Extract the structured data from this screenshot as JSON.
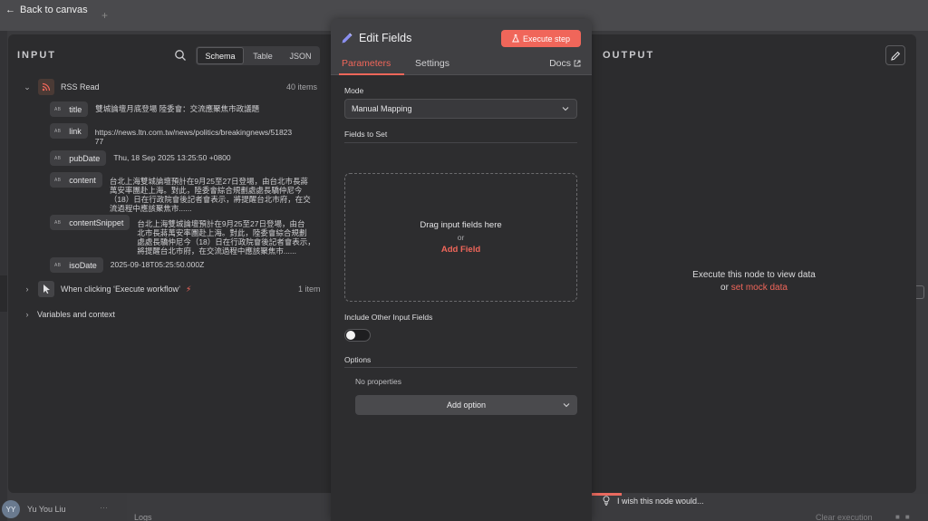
{
  "topbar": {
    "back_label": "Back to canvas",
    "back_icon": "arrow-left-icon"
  },
  "user": {
    "initials": "YY",
    "name": "Yu You Liu"
  },
  "bottom": {
    "logs_label": "Logs",
    "clear_label": "Clear execution"
  },
  "input": {
    "title": "INPUT",
    "view_tabs": [
      "Schema",
      "Table",
      "JSON"
    ],
    "active_view": "Schema",
    "nodes": [
      {
        "name": "RSS Read",
        "count": "40 items",
        "expanded": true
      },
      {
        "name": "When clicking ‘Execute workflow’",
        "count": "1 item",
        "expanded": false
      },
      {
        "name": "Variables and context"
      }
    ],
    "fields": [
      {
        "key": "title",
        "type_badge": "AB",
        "value": "雙城論壇月底登場 陸委會：交流應聚焦市政議題"
      },
      {
        "key": "link",
        "type_badge": "AB",
        "value_line1": "https://news.ltn.com.tw/news/politics/breakingnews/51823",
        "value_line2": "77"
      },
      {
        "key": "pubDate",
        "type_badge": "AB",
        "value": "Thu, 18 Sep 2025 13:25:50 +0800"
      },
      {
        "key": "content",
        "type_badge": "AB",
        "value_line1": "台北上海雙城論壇預計在9月25至27日登場，由台北市長蔣",
        "value_line2": "萬安率團赴上海。對此，陸委會綜合規劃處處長驕仲尼今",
        "value_line3": "（18）日在行政院會後記者會表示，將提醒台北市府，在交",
        "value_line4": "流過程中應該聚焦市......"
      },
      {
        "key": "contentSnippet",
        "type_badge": "AB",
        "value_line1": "台北上海雙城論壇預計在9月25至27日登場，由台",
        "value_line2": "北市長蔣萬安率團赴上海。對此，陸委會綜合規劃",
        "value_line3": "處處長驕仲尼今（18）日在行政院會後記者會表示，",
        "value_line4": "將提醒台北市府，在交流過程中應該聚焦市......"
      },
      {
        "key": "isoDate",
        "type_badge": "AB",
        "value": "2025-09-18T05:25:50.000Z"
      }
    ]
  },
  "edit": {
    "title": "Edit Fields",
    "execute_label": "Execute step",
    "tabs": [
      "Parameters",
      "Settings"
    ],
    "active_tab": "Parameters",
    "docs_label": "Docs",
    "mode_label": "Mode",
    "mode_value": "Manual Mapping",
    "fields_to_set_label": "Fields to Set",
    "drop_text": "Drag input fields here",
    "or_text": "or",
    "add_field_label": "Add Field",
    "include_label": "Include Other Input Fields",
    "include_on": false,
    "options_label": "Options",
    "no_props": "No properties",
    "add_option_label": "Add option"
  },
  "output": {
    "title": "OUTPUT",
    "msg_line1": "Execute this node to view data",
    "msg_or": "or",
    "mock_link": "set mock data"
  },
  "feedback": {
    "text": "I wish this node would..."
  },
  "colors": {
    "accent": "#f0665a",
    "panel_bg": "#2c2c2e",
    "modal_header": "#404043"
  }
}
